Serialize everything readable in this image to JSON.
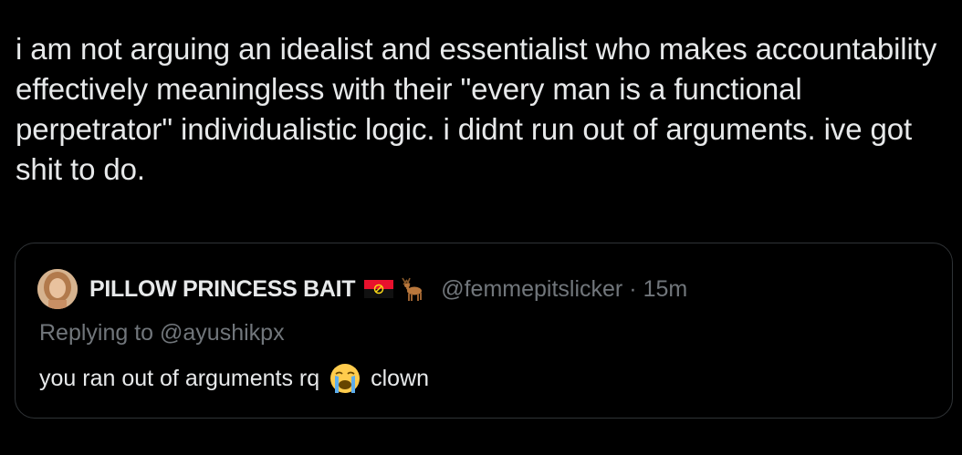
{
  "tweet": {
    "text": "i am not arguing an idealist and essentialist who makes accountability effectively meaningless with their \"every man is a functional perpetrator\" individualistic logic. i didnt run out of arguments. ive got shit to do."
  },
  "quote": {
    "display_name": "PILLOW PRINCESS BAIT",
    "name_emojis": [
      "angola-flag-icon",
      "deer-icon"
    ],
    "handle": "@femmepitslicker",
    "separator": "·",
    "time": "15m",
    "replying_to": "Replying to @ayushikpx",
    "text_before": "you ran out of arguments rq",
    "text_emoji": "loudly-crying-face-icon",
    "text_after": "clown"
  },
  "colors": {
    "background": "#000000",
    "text_primary": "#e7e9ea",
    "text_secondary": "#71767b",
    "border": "#2f3336"
  }
}
